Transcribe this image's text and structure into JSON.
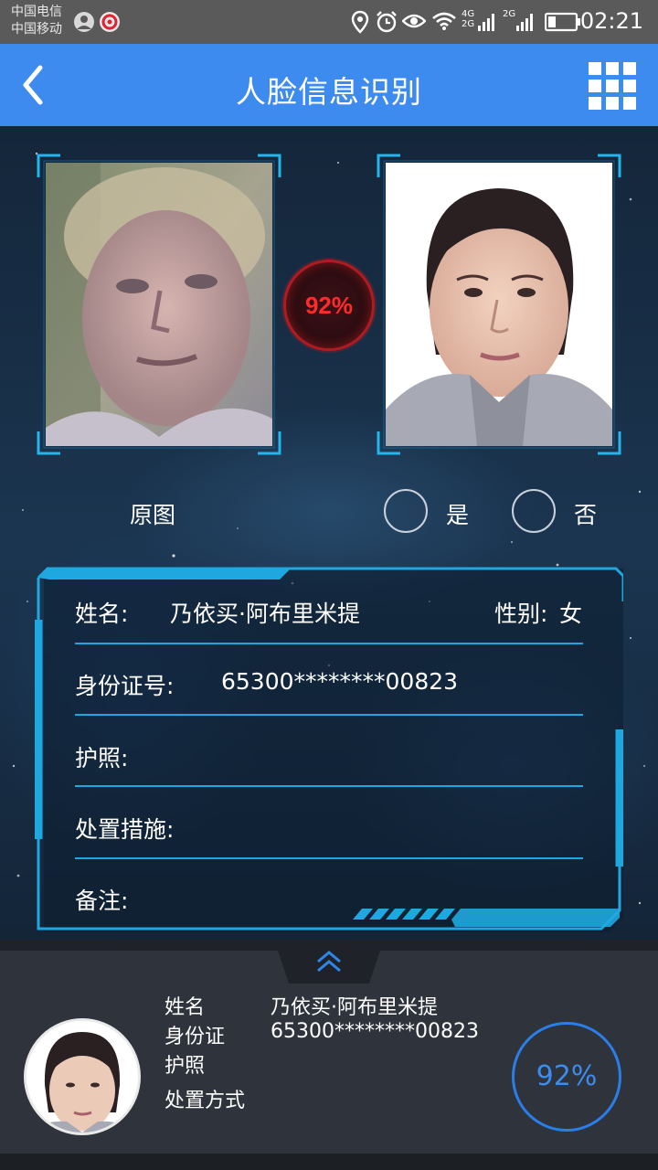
{
  "status_bar": {
    "carrier_1": "中国电信",
    "carrier_2": "中国移动",
    "network_1": "4G",
    "network_2": "2G",
    "network_3": "2G",
    "time": "02:21"
  },
  "header": {
    "title": "人脸信息识别",
    "back_icon": "chevron-left-icon",
    "menu_icon": "grid-icon"
  },
  "comparison": {
    "match_score": "92%",
    "original_label": "原图",
    "yes_label": "是",
    "no_label": "否"
  },
  "info_card": {
    "name_label": "姓名:",
    "name_value": "乃依买·阿布里米提",
    "gender_label": "性别:",
    "gender_value": "女",
    "id_label": "身份证号:",
    "id_value": "65300********00823",
    "passport_label": "护照:",
    "disposal_label": "处置措施:",
    "remark_label": "备注:"
  },
  "bottom_panel": {
    "name_label": "姓名",
    "name_value": "乃依买·阿布里米提",
    "id_label": "身份证",
    "id_value": "65300********00823",
    "passport_label": "护照",
    "disposal_label": "处置方式",
    "score": "92%"
  },
  "colors": {
    "header_bg": "#3d8bee",
    "accent_cyan": "#1fa8e0",
    "match_red": "#ff2a2a",
    "score_blue": "#2b7de8"
  }
}
